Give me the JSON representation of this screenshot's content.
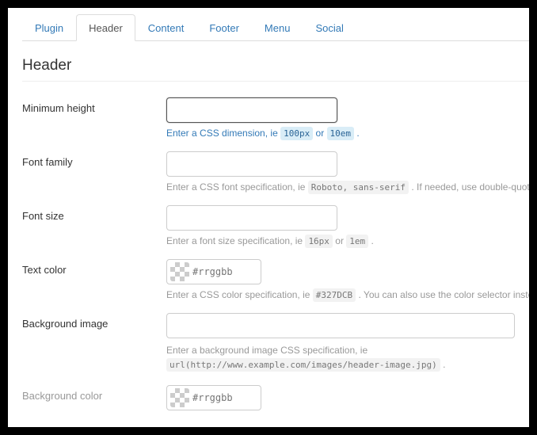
{
  "tabs": [
    {
      "label": "Plugin"
    },
    {
      "label": "Header"
    },
    {
      "label": "Content"
    },
    {
      "label": "Footer"
    },
    {
      "label": "Menu"
    },
    {
      "label": "Social"
    }
  ],
  "active_tab_index": 1,
  "section_title": "Header",
  "fields": {
    "min_height": {
      "label": "Minimum height",
      "value": "",
      "help_pre": "Enter a CSS dimension, ie ",
      "code1": "100px",
      "help_mid": " or ",
      "code2": "10em",
      "help_post": " ."
    },
    "font_family": {
      "label": "Font family",
      "value": "",
      "help_pre": "Enter a CSS font specification, ie ",
      "code1": "Roboto, sans-serif",
      "help_post": " . If needed, use double-quote but no simple quote."
    },
    "font_size": {
      "label": "Font size",
      "value": "",
      "help_pre": "Enter a font size specification, ie ",
      "code1": "16px",
      "help_mid": " or ",
      "code2": "1em",
      "help_post": " ."
    },
    "text_color": {
      "label": "Text color",
      "placeholder": "#rrggbb",
      "help_pre": "Enter a CSS color specification, ie ",
      "code1": "#327DCB",
      "help_post": " . You can also use the color selector instead."
    },
    "bg_image": {
      "label": "Background image",
      "value": "",
      "help_line": "Enter a background image CSS specification, ie",
      "code1": "url(http://www.example.com/images/header-image.jpg)",
      "help_post": " ."
    },
    "bg_color": {
      "label": "Background color",
      "placeholder": "#rrggbb"
    }
  }
}
